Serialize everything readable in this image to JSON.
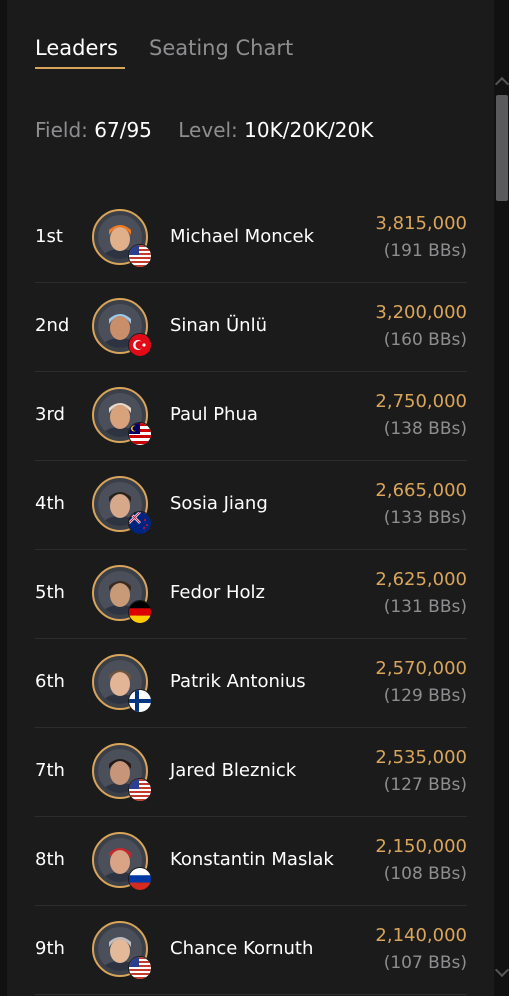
{
  "tabs": [
    {
      "label": "Leaders",
      "active": true
    },
    {
      "label": "Seating Chart",
      "active": false
    }
  ],
  "summary": {
    "field_label": "Field:",
    "field_value": "67/95",
    "level_label": "Level:",
    "level_value": "10K/20K/20K"
  },
  "players": [
    {
      "rank": "1st",
      "name": "Michael Moncek",
      "chips": "3,815,000",
      "bbs": "(191 BBs)",
      "flag": "us-flag-icon"
    },
    {
      "rank": "2nd",
      "name": "Sinan Ünlü",
      "chips": "3,200,000",
      "bbs": "(160 BBs)",
      "flag": "turkey-flag-icon"
    },
    {
      "rank": "3rd",
      "name": "Paul Phua",
      "chips": "2,750,000",
      "bbs": "(138 BBs)",
      "flag": "malaysia-flag-icon"
    },
    {
      "rank": "4th",
      "name": "Sosia Jiang",
      "chips": "2,665,000",
      "bbs": "(133 BBs)",
      "flag": "new-zealand-flag-icon"
    },
    {
      "rank": "5th",
      "name": "Fedor Holz",
      "chips": "2,625,000",
      "bbs": "(131 BBs)",
      "flag": "germany-flag-icon"
    },
    {
      "rank": "6th",
      "name": "Patrik Antonius",
      "chips": "2,570,000",
      "bbs": "(129 BBs)",
      "flag": "finland-flag-icon"
    },
    {
      "rank": "7th",
      "name": "Jared Bleznick",
      "chips": "2,535,000",
      "bbs": "(127 BBs)",
      "flag": "us-flag-icon"
    },
    {
      "rank": "8th",
      "name": "Konstantin Maslak",
      "chips": "2,150,000",
      "bbs": "(108 BBs)",
      "flag": "russia-flag-icon"
    },
    {
      "rank": "9th",
      "name": "Chance Kornuth",
      "chips": "2,140,000",
      "bbs": "(107 BBs)",
      "flag": "us-flag-icon"
    }
  ],
  "colors": {
    "accent": "#d9a55a",
    "background": "#1b1b1c",
    "muted_text": "#8e8e90"
  }
}
